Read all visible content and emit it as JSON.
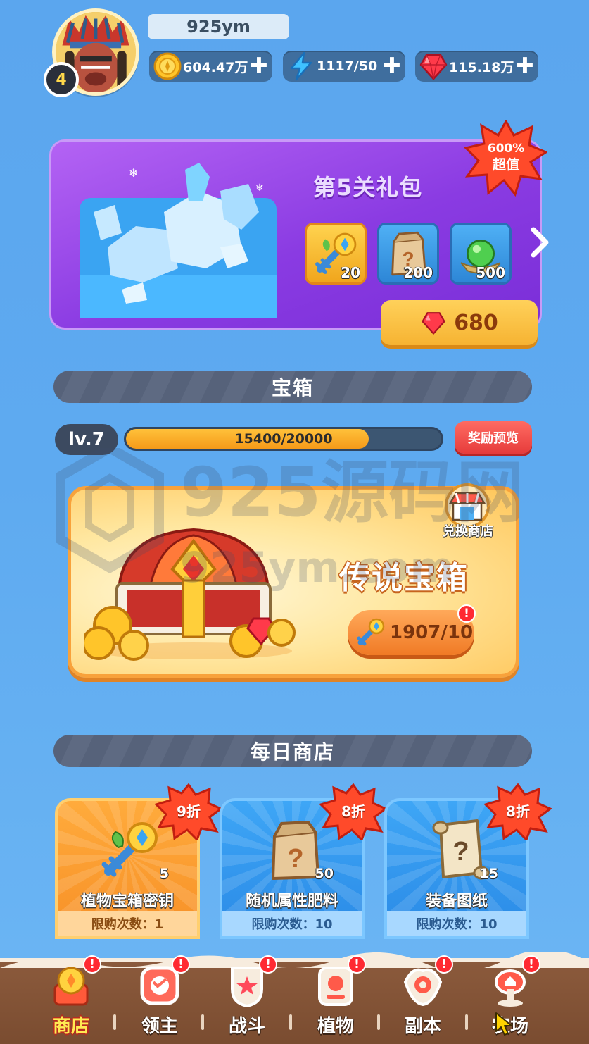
{
  "header": {
    "username": "925ym",
    "level": "4",
    "resources": [
      {
        "icon": "gold-coin-icon",
        "value": "604.47万"
      },
      {
        "icon": "energy-bolt-icon",
        "value": "1117/50"
      },
      {
        "icon": "red-gem-icon",
        "value": "115.18万"
      }
    ]
  },
  "gift_pack": {
    "title": "第5关礼包",
    "badge": "600%超值",
    "items": [
      {
        "icon": "chest-key-icon",
        "count": "20"
      },
      {
        "icon": "mystery-bag-icon",
        "count": "200"
      },
      {
        "icon": "green-orb-icon",
        "count": "500"
      }
    ],
    "price": "680"
  },
  "chest_section": {
    "title": "宝箱",
    "level_label": "lv.7",
    "progress_text": "15400/20000",
    "progress_fraction": 0.77,
    "preview_label": "奖励预览",
    "card_title": "传说宝箱",
    "exchange_label": "兑换商店",
    "key_count": "1907/10",
    "alert": "!"
  },
  "daily_shop": {
    "title": "每日商店",
    "items": [
      {
        "name": "植物宝箱密钥",
        "count": "5",
        "discount": "9折",
        "limit": "限购次数：1",
        "style": "orange",
        "icon": "chest-key-icon"
      },
      {
        "name": "随机属性肥料",
        "count": "50",
        "discount": "8折",
        "limit": "限购次数：10",
        "style": "blue",
        "icon": "mystery-bag-icon"
      },
      {
        "name": "装备图纸",
        "count": "15",
        "discount": "8折",
        "limit": "限购次数：10",
        "style": "blue",
        "icon": "blueprint-scroll-icon"
      }
    ]
  },
  "bottom_nav": [
    {
      "label": "商店",
      "icon": "shop-icon",
      "active": true
    },
    {
      "label": "领主",
      "icon": "lord-icon",
      "active": false
    },
    {
      "label": "战斗",
      "icon": "battle-icon",
      "active": false
    },
    {
      "label": "植物",
      "icon": "plant-icon",
      "active": false
    },
    {
      "label": "副本",
      "icon": "dungeon-icon",
      "active": false
    },
    {
      "label": "农场",
      "icon": "farm-icon",
      "active": false
    }
  ],
  "watermark": "925源码网 925ym.com",
  "colors": {
    "background": "#5ba6ee",
    "gift_purple": "#8a3be2",
    "progress_orange": "#f59a19",
    "nav_brown": "#7a4c30",
    "alert_red": "#ff2a32"
  }
}
